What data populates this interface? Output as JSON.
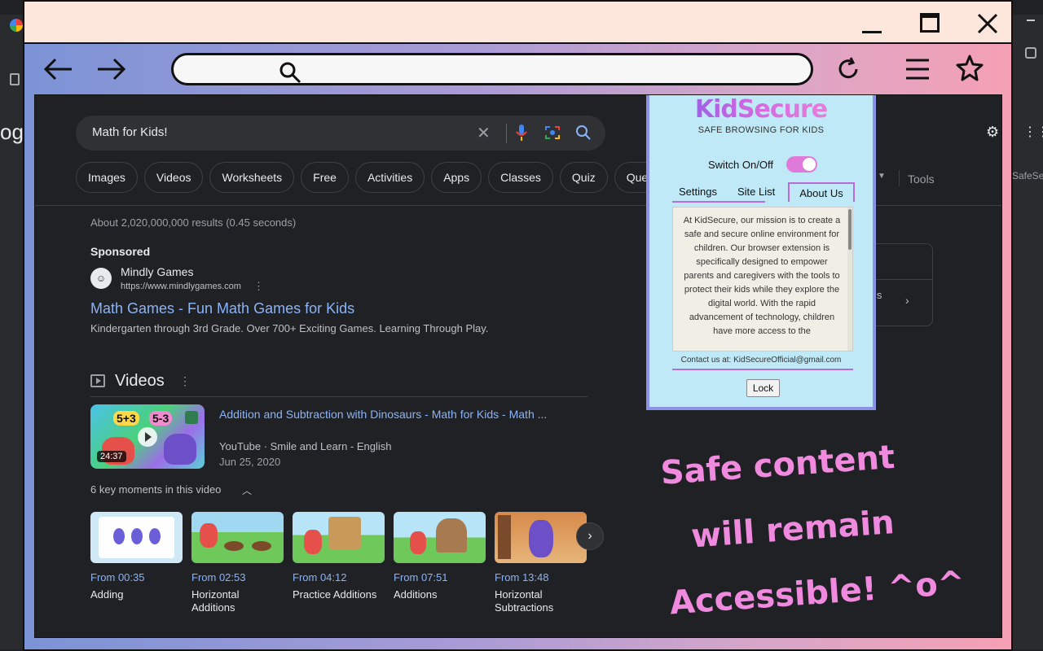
{
  "search": {
    "query": "Math for Kids!",
    "chips": [
      "Images",
      "Videos",
      "Worksheets",
      "Free",
      "Activities",
      "Apps",
      "Classes",
      "Quiz",
      "Questions"
    ],
    "tools": "Tools",
    "results_count": "About 2,020,000,000 results (0.45 seconds)"
  },
  "background": {
    "logo_fragment": "og",
    "safe_fragment": "SafeSe"
  },
  "ad": {
    "label": "Sponsored",
    "name": "Mindly Games",
    "url": "https://www.mindlygames.com",
    "title": "Math Games - Fun Math Games for Kids",
    "desc": "Kindergarten through 3rd Grade. Over 700+ Exciting Games. Learning Through Play."
  },
  "videos": {
    "heading": "Videos",
    "item": {
      "title": "Addition and Subtraction with Dinosaurs - Math for Kids - Math ...",
      "source": "YouTube · Smile and Learn - English",
      "date": "Jun 25, 2020",
      "duration": "24:37",
      "thumb_a": "5+3",
      "thumb_b": "5-3"
    },
    "key_moments": "6 key moments in this video",
    "moments": [
      {
        "time": "From 00:35",
        "label": "Adding"
      },
      {
        "time": "From 02:53",
        "label": "Horizontal Additions"
      },
      {
        "time": "From 04:12",
        "label": "Practice Additions"
      },
      {
        "time": "From 07:51",
        "label": "Additions"
      },
      {
        "time": "From 13:48",
        "label": "Horizontal Subtractions"
      }
    ]
  },
  "side_card": {
    "text": "ls"
  },
  "popup": {
    "brand": "KidSecure",
    "tagline": "SAFE BROWSING FOR KIDS",
    "switch_label": "Switch On/Off",
    "tabs": [
      "Settings",
      "Site List",
      "About Us"
    ],
    "about": "At KidSecure, our mission is to create a safe and secure online environment for children. Our browser extension is specifically designed to empower parents and caregivers with the tools to protect their kids while they explore the digital world. With the rapid advancement of technology, children have more access to the",
    "contact": "Contact us at: KidSecureOfficial@gmail.com",
    "lock": "Lock"
  },
  "slogan": {
    "line1": "Safe content",
    "line2": "will remain",
    "line3": "Accessible! ^o^"
  },
  "colors": {
    "accent_pink": "#f08adf",
    "popup_bg": "#bfe9f6",
    "link_blue": "#8ab4f8"
  }
}
